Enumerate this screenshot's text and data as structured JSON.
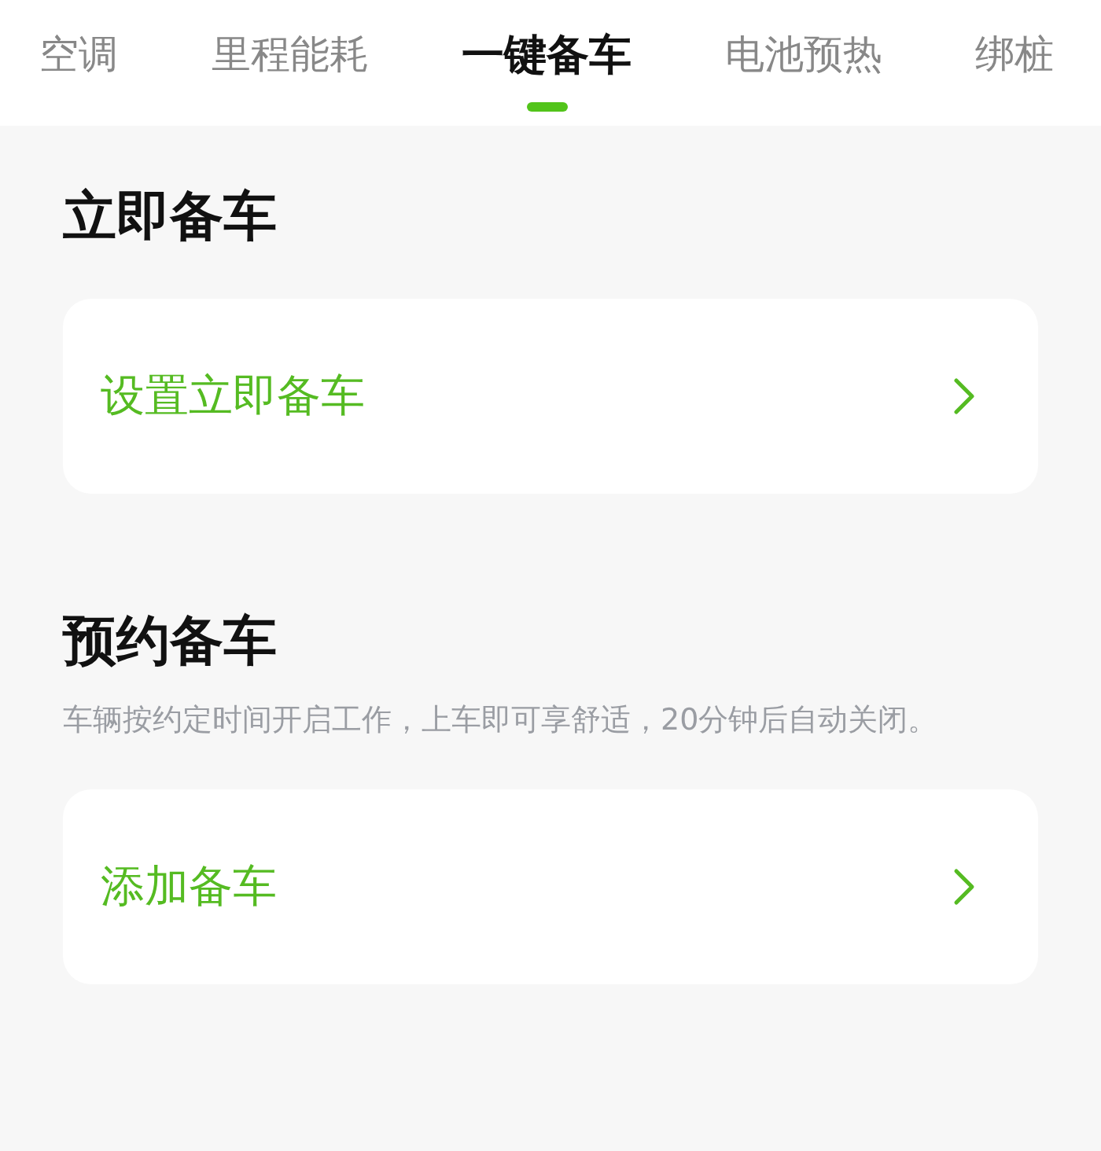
{
  "tabs": [
    {
      "label": "空调",
      "selected": false
    },
    {
      "label": "里程能耗",
      "selected": false
    },
    {
      "label": "一键备车",
      "selected": true
    },
    {
      "label": "电池预热",
      "selected": false
    },
    {
      "label": "绑桩",
      "selected": false
    }
  ],
  "sections": [
    {
      "title": "立即备车",
      "items": [
        {
          "label": "设置立即备车"
        }
      ]
    },
    {
      "title": "预约备车",
      "description": "车辆按约定时间开启工作，上车即可享舒适，20分钟后自动关闭。",
      "items": [
        {
          "label": "添加备车"
        }
      ]
    }
  ]
}
